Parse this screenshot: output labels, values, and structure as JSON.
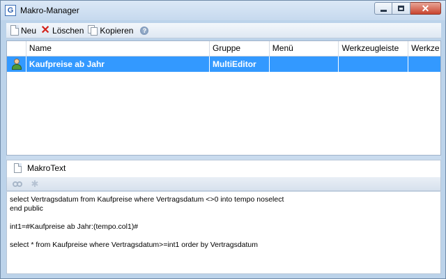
{
  "window": {
    "title": "Makro-Manager",
    "app_icon_text": "G",
    "close_glyph": "✕"
  },
  "toolbar": {
    "new_label": "Neu",
    "delete_label": "Löschen",
    "copy_label": "Kopieren",
    "help_glyph": "?"
  },
  "grid": {
    "columns": [
      "Name",
      "Gruppe",
      "Menü",
      "Werkzeugleiste",
      "Werkze"
    ],
    "rows": [
      {
        "name": "Kaufpreise ab Jahr",
        "group": "MultiEditor",
        "menu": "",
        "toolbar": "",
        "toolbar2": ""
      }
    ]
  },
  "editor_tab": {
    "label": "MakroText"
  },
  "editor": {
    "lines": [
      "select Vertragsdatum from Kaufpreise where Vertragsdatum <>0 into tempo noselect",
      "end public",
      "",
      "int1=#Kaufpreise ab Jahr:(tempo.col1)#",
      "",
      "select * from Kaufpreise where Vertragsdatum>=int1 order by Vertragsdatum"
    ]
  },
  "colors": {
    "selection": "#3399ff",
    "window_frame": "#bcd3ea",
    "delete_icon": "#d3221b"
  }
}
